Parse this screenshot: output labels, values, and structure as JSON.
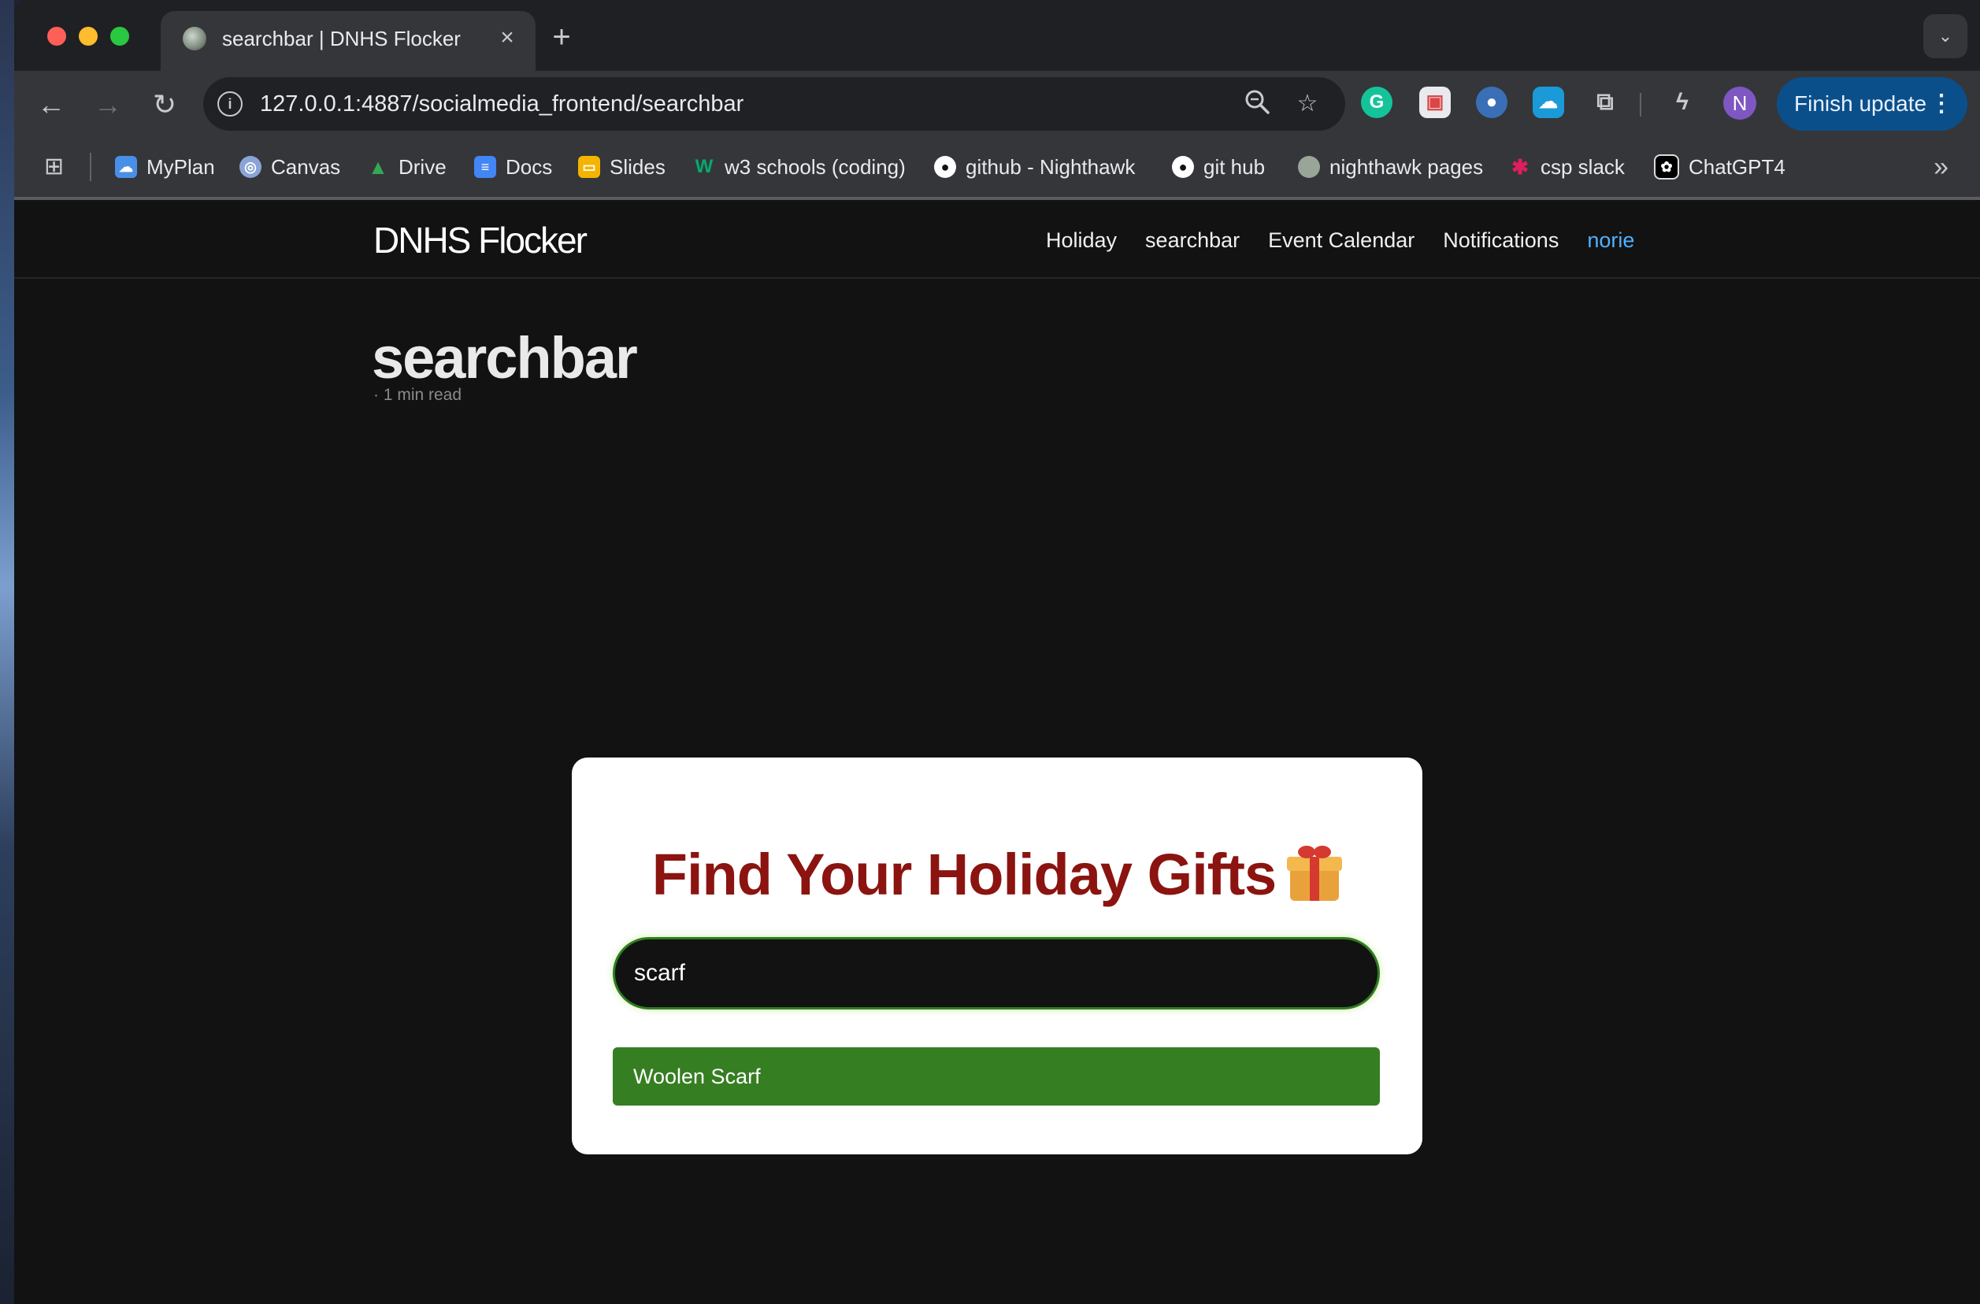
{
  "browser": {
    "tab": {
      "title": "searchbar | DNHS Flocker"
    },
    "address_bar": {
      "url": "127.0.0.1:4887/socialmedia_frontend/searchbar"
    },
    "profile_initial": "N",
    "finish_update_label": "Finish update",
    "bookmarks": [
      {
        "label": "MyPlan",
        "icon": "cloud-icon",
        "color": "#4a8fe7"
      },
      {
        "label": "Canvas",
        "icon": "canvas-icon",
        "color": "#8aa4d6"
      },
      {
        "label": "Drive",
        "icon": "drive-icon",
        "color": "#34a853"
      },
      {
        "label": "Docs",
        "icon": "docs-icon",
        "color": "#4285f4"
      },
      {
        "label": "Slides",
        "icon": "slides-icon",
        "color": "#f4b400"
      },
      {
        "label": "w3 schools (coding)",
        "icon": "w3schools-icon",
        "color": "#04aa6d"
      },
      {
        "label": "github - Nighthawk",
        "icon": "github-icon",
        "color": "#ffffff"
      },
      {
        "label": "git hub",
        "icon": "github-icon",
        "color": "#ffffff"
      },
      {
        "label": "nighthawk pages",
        "icon": "globe-icon",
        "color": "#9aa59a"
      },
      {
        "label": "csp slack",
        "icon": "slack-icon",
        "color": "#e01e5a"
      },
      {
        "label": "ChatGPT4",
        "icon": "openai-icon",
        "color": "#ffffff"
      }
    ]
  },
  "site": {
    "title": "DNHS Flocker",
    "nav": [
      {
        "label": "Holiday"
      },
      {
        "label": "searchbar"
      },
      {
        "label": "Event Calendar"
      },
      {
        "label": "Notifications"
      },
      {
        "label": "norie"
      }
    ]
  },
  "page": {
    "title": "searchbar",
    "reading_time": "· 1 min read"
  },
  "search_card": {
    "heading": "Find Your Holiday Gifts",
    "search_value": "scarf",
    "results": [
      {
        "label": "Woolen Scarf"
      }
    ]
  },
  "colors": {
    "heading": "#8b1410",
    "result_bg": "#367e22",
    "nav_active": "#4fb0ff",
    "update_button": "#0b4f8a"
  }
}
